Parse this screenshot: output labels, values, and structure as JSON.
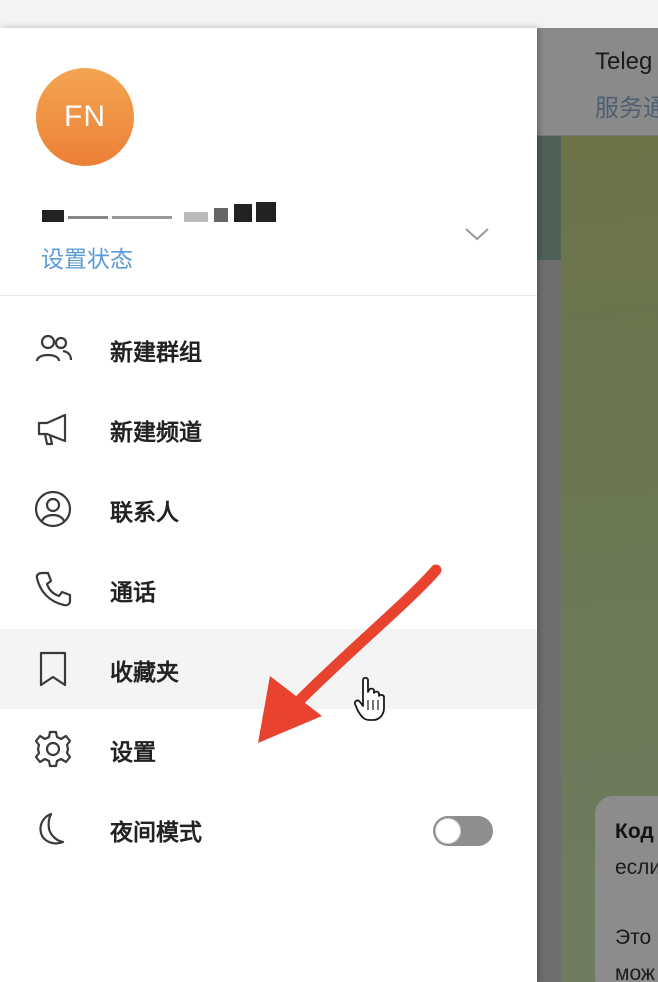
{
  "profile": {
    "avatar_initials": "FN",
    "avatar_color": "#ef8a3c",
    "set_status_label": "设置状态"
  },
  "menu": {
    "items": [
      {
        "label": "新建群组",
        "icon": "group-icon"
      },
      {
        "label": "新建频道",
        "icon": "megaphone-icon"
      },
      {
        "label": "联系人",
        "icon": "contact-icon"
      },
      {
        "label": "通话",
        "icon": "phone-icon"
      },
      {
        "label": "收藏夹",
        "icon": "bookmark-icon",
        "hovered": true
      },
      {
        "label": "设置",
        "icon": "gear-icon"
      },
      {
        "label": "夜间模式",
        "icon": "moon-icon",
        "toggle": false
      }
    ]
  },
  "chat": {
    "title": "Teleg",
    "subtitle": "服务通",
    "bubble_line1": "Код",
    "bubble_line2": "если",
    "bubble_line3": "Это",
    "bubble_line4": "мож"
  },
  "colors": {
    "link": "#5b9bd5",
    "annotation_arrow": "#e8432f",
    "toggle_off": "#8e8e8e"
  }
}
